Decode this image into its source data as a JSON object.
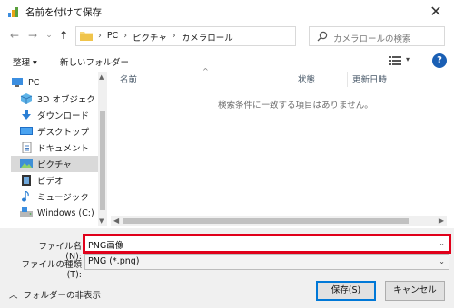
{
  "window": {
    "title": "名前を付けて保存",
    "close_glyph": "✕"
  },
  "nav": {
    "back_glyph": "←",
    "forward_glyph": "→",
    "recent_glyph": "⌄",
    "up_glyph": "↑",
    "breadcrumb": [
      "PC",
      "ピクチャ",
      "カメラロール"
    ],
    "breadcrumb_sep": "›",
    "search_placeholder": "カメラロールの検索"
  },
  "toolbar": {
    "organize": "整理 ▾",
    "new_folder": "新しいフォルダー",
    "view_dropdown_glyph": "▾",
    "help": "?"
  },
  "sidebar": {
    "items": [
      {
        "label": "PC",
        "icon": "pc-icon"
      },
      {
        "label": "3D オブジェクト",
        "icon": "3d-objects-icon"
      },
      {
        "label": "ダウンロード",
        "icon": "download-icon"
      },
      {
        "label": "デスクトップ",
        "icon": "desktop-icon"
      },
      {
        "label": "ドキュメント",
        "icon": "documents-icon"
      },
      {
        "label": "ピクチャ",
        "icon": "pictures-icon",
        "selected": true
      },
      {
        "label": "ビデオ",
        "icon": "videos-icon"
      },
      {
        "label": "ミュージック",
        "icon": "music-icon"
      },
      {
        "label": "Windows (C:)",
        "icon": "drive-icon"
      }
    ]
  },
  "file_list": {
    "columns": [
      "名前",
      "状態",
      "更新日時"
    ],
    "empty_message": "検索条件に一致する項目はありません。"
  },
  "form": {
    "filename_label": "ファイル名(N):",
    "filename_value": "PNG画像",
    "filetype_label": "ファイルの種類(T):",
    "filetype_value": "PNG (*.png)",
    "dropdown_glyph": "⌄"
  },
  "footer": {
    "hide_folders": "フォルダーの非表示",
    "save": "保存(S)",
    "cancel": "キャンセル"
  },
  "colors": {
    "highlight": "#e0001a",
    "accent": "#0078d7",
    "selected_bg": "#d9d9d9"
  }
}
